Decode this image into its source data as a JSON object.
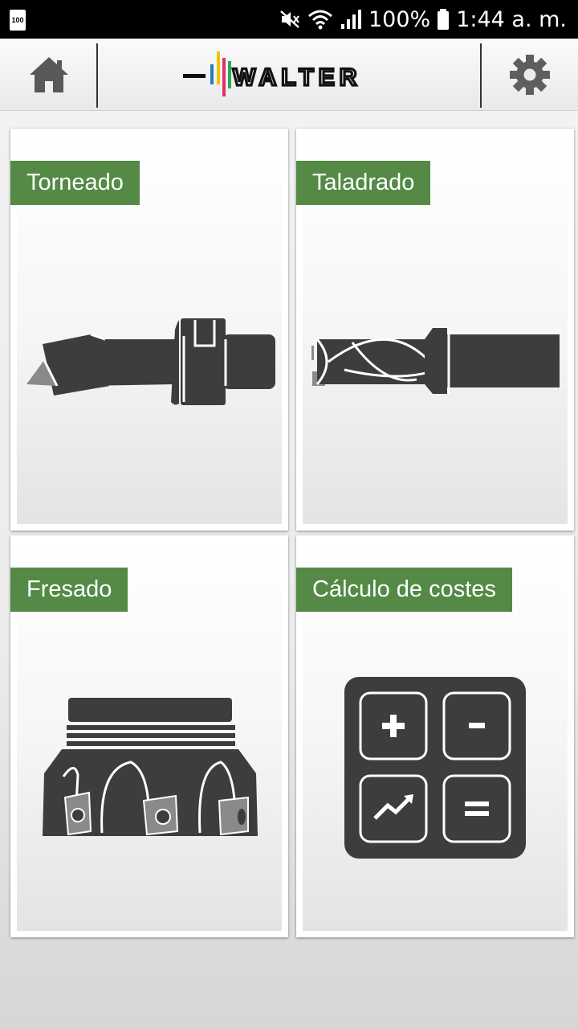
{
  "status_bar": {
    "battery_small": "100",
    "battery_percent": "100%",
    "time": "1:44 a. m."
  },
  "header": {
    "logo_text": "WALTER",
    "home_icon": "home-icon",
    "settings_icon": "gear-icon"
  },
  "cards": [
    {
      "label": "Torneado",
      "icon": "turning-tool-icon"
    },
    {
      "label": "Taladrado",
      "icon": "drill-icon"
    },
    {
      "label": "Fresado",
      "icon": "milling-cutter-icon"
    },
    {
      "label": "Cálculo de costes",
      "icon": "calculator-icon"
    }
  ],
  "colors": {
    "label_green": "#548a45",
    "icon_dark": "#3a3a3a",
    "logo_bars": [
      "#1f7fc1",
      "#f2c200",
      "#e0306b",
      "#2fa84f"
    ]
  }
}
